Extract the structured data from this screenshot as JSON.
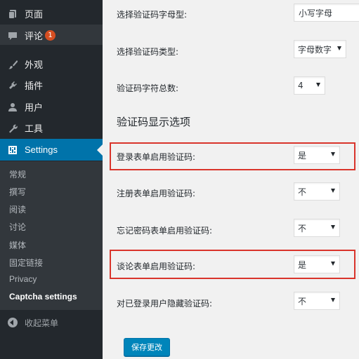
{
  "sidebar": {
    "menu": [
      {
        "label": "页面",
        "icon": "pages-icon"
      },
      {
        "label": "评论",
        "icon": "comments-icon",
        "badge": "1"
      },
      {
        "label": "外观",
        "icon": "appearance-brush-icon"
      },
      {
        "label": "插件",
        "icon": "plugins-icon"
      },
      {
        "label": "用户",
        "icon": "users-icon"
      },
      {
        "label": "工具",
        "icon": "tools-wrench-icon"
      },
      {
        "label": "Settings",
        "icon": "settings-icon",
        "active": true
      }
    ],
    "submenu": [
      {
        "label": "常规"
      },
      {
        "label": "撰写"
      },
      {
        "label": "阅读"
      },
      {
        "label": "讨论"
      },
      {
        "label": "媒体"
      },
      {
        "label": "固定链接"
      },
      {
        "label": "Privacy"
      },
      {
        "label": "Captcha settings",
        "current": true
      }
    ],
    "collapse_label": "收起菜单"
  },
  "settings": {
    "rows_top": [
      {
        "label": "选择验证码字母型:",
        "value": "小写字母",
        "control": "text-input"
      },
      {
        "label": "选择验证码类型:",
        "value": "字母数字",
        "control": "select"
      },
      {
        "label": "验证码字符总数:",
        "value": "4",
        "control": "select"
      }
    ],
    "section_title": "验证码显示选项",
    "rows_display": [
      {
        "label": "登录表单启用验证码:",
        "value": "是",
        "highlighted": true
      },
      {
        "label": "注册表单启用验证码:",
        "value": "不",
        "highlighted": false
      },
      {
        "label": "忘记密码表单启用验证码:",
        "value": "不",
        "highlighted": false
      },
      {
        "label": "谈论表单启用验证码:",
        "value": "是",
        "highlighted": true
      },
      {
        "label": "对已登录用户隐藏验证码:",
        "value": "不",
        "highlighted": false
      }
    ],
    "save_label": "保存更改"
  },
  "colors": {
    "sidebar_bg": "#23282d",
    "submenu_bg": "#32373c",
    "active_blue": "#0073aa",
    "badge_orange": "#d54e21",
    "highlight_red": "#d9342b",
    "button_blue": "#0085ba"
  }
}
